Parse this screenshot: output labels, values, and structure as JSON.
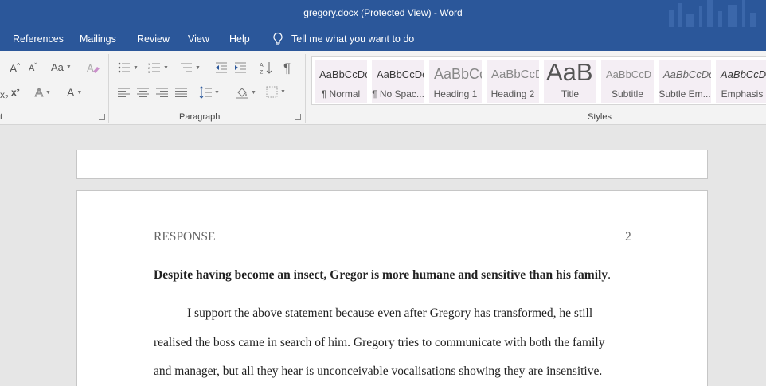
{
  "window": {
    "title": "gregory.docx (Protected View)  -  Word"
  },
  "menu": {
    "tabs": [
      "References",
      "Mailings",
      "Review",
      "View",
      "Help"
    ],
    "tell_me": "Tell me what you want to do"
  },
  "ribbon": {
    "font_group_label": "t",
    "paragraph_group_label": "Paragraph",
    "styles_group_label": "Styles",
    "styles": [
      {
        "preview": "AaBbCcDc",
        "label": "¶ Normal"
      },
      {
        "preview": "AaBbCcDc",
        "label": "¶ No Spac..."
      },
      {
        "preview": "AaBbCc",
        "label": "Heading 1"
      },
      {
        "preview": "AaBbCcD",
        "label": "Heading 2"
      },
      {
        "preview": "AaB",
        "label": "Title"
      },
      {
        "preview": "AaBbCcD",
        "label": "Subtitle"
      },
      {
        "preview": "AaBbCcDc",
        "label": "Subtle Em..."
      },
      {
        "preview": "AaBbCcDc",
        "label": "Emphasis"
      }
    ],
    "font_buttons": {
      "grow": "A",
      "shrink": "A",
      "case": "Aa",
      "color": "A",
      "superscript": "x²",
      "subscript": "x",
      "effects": "A"
    }
  },
  "document": {
    "running_head": "RESPONSE",
    "page_number": "2",
    "heading_bold": "Despite having become an insect, Gregor is more humane and sensitive than his family",
    "heading_tail": ".",
    "paragraph_lines": [
      "I support the above statement because even after Gregory has transformed, he still",
      "realised the boss came in search of him. Gregory tries to communicate with both the family",
      "and manager, but all they hear is unconceivable vocalisations showing they are insensitive."
    ]
  },
  "colors": {
    "title_bar": "#2b579a",
    "ribbon_bg": "#f3f3f3",
    "doc_bg": "#e6e6e6",
    "style_tile_bg": "#f4eef4"
  }
}
